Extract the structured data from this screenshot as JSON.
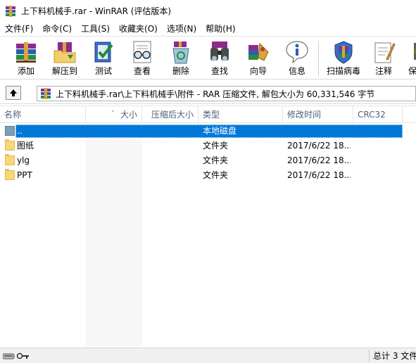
{
  "window": {
    "title": "上下料机械手.rar - WinRAR (评估版本)"
  },
  "menu": [
    {
      "label": "文件(F)"
    },
    {
      "label": "命令(C)"
    },
    {
      "label": "工具(S)"
    },
    {
      "label": "收藏夹(O)"
    },
    {
      "label": "选项(N)"
    },
    {
      "label": "帮助(H)"
    }
  ],
  "toolbar": {
    "buttons": [
      {
        "label": "添加",
        "icon": "books-add-icon"
      },
      {
        "label": "解压到",
        "icon": "extract-folder-icon"
      },
      {
        "label": "测试",
        "icon": "test-check-icon"
      },
      {
        "label": "查看",
        "icon": "view-glasses-icon"
      },
      {
        "label": "删除",
        "icon": "recycle-bin-icon"
      },
      {
        "label": "查找",
        "icon": "binoculars-icon"
      },
      {
        "label": "向导",
        "icon": "wizard-icon"
      },
      {
        "label": "信息",
        "icon": "info-icon"
      },
      {
        "label": "扫描病毒",
        "icon": "virus-scan-icon"
      },
      {
        "label": "注释",
        "icon": "comment-icon"
      },
      {
        "label": "保",
        "icon": "protect-icon"
      }
    ]
  },
  "address": {
    "path": "上下料机械手.rar\\上下料机械手\\附件 - RAR 压缩文件, 解包大小为 60,331,546 字节"
  },
  "columns": [
    {
      "label": "名称"
    },
    {
      "label": "大小"
    },
    {
      "label": "压缩后大小"
    },
    {
      "label": "类型"
    },
    {
      "label": "修改时间"
    },
    {
      "label": "CRC32"
    }
  ],
  "rows": [
    {
      "name": "..",
      "size": "",
      "packed": "",
      "type": "本地磁盘",
      "modified": "",
      "crc": "",
      "kind": "parent",
      "selected": true
    },
    {
      "name": "图纸",
      "size": "",
      "packed": "",
      "type": "文件夹",
      "modified": "2017/6/22 18...",
      "crc": "",
      "kind": "folder",
      "selected": false
    },
    {
      "name": "ylg",
      "size": "",
      "packed": "",
      "type": "文件夹",
      "modified": "2017/6/22 18...",
      "crc": "",
      "kind": "folder",
      "selected": false
    },
    {
      "name": "PPT",
      "size": "",
      "packed": "",
      "type": "文件夹",
      "modified": "2017/6/22 18...",
      "crc": "",
      "kind": "folder",
      "selected": false
    }
  ],
  "status": {
    "text": "总计 3 文件"
  },
  "colors": {
    "selection": "#0078d7",
    "header_text": "#4c607a",
    "folder": "#f6d77c"
  }
}
